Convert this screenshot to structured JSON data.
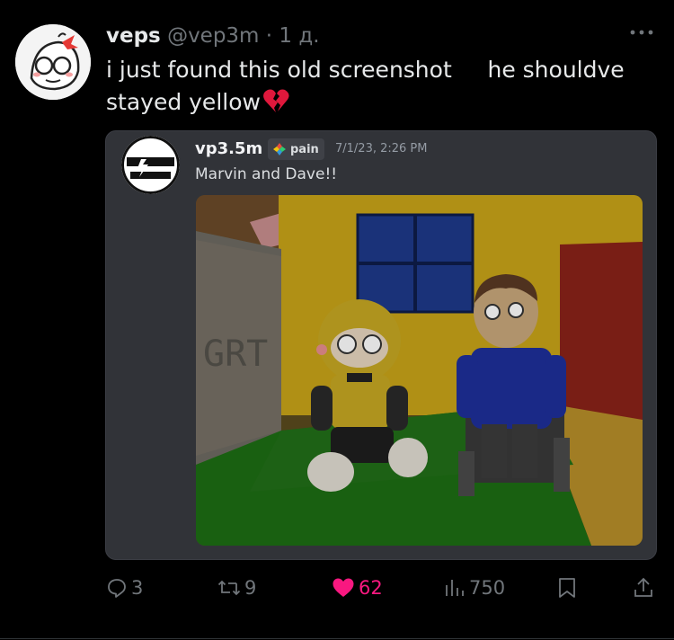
{
  "post": {
    "display_name": "veps",
    "handle": "@vep3m",
    "separator": "·",
    "time": "1 д.",
    "more_icon": "more-horizontal-icon",
    "text": "i just found this old screenshot     he shouldve stayed yellow",
    "emoji": "broken-heart"
  },
  "embed": {
    "username": "vp3.5m",
    "tag_label": "pain",
    "timestamp": "7/1/23, 2:26 PM",
    "message": "Marvin and Dave!!",
    "image_description_icon": "game-screenshot",
    "wall_sign_text": "GRT"
  },
  "actions": {
    "replies": "3",
    "reposts": "9",
    "likes": "62",
    "views": "750",
    "bookmark_icon": "bookmark-icon",
    "share_icon": "share-icon"
  },
  "colors": {
    "like_active": "#f91880",
    "muted": "#71767b",
    "card_bg": "#313338"
  }
}
